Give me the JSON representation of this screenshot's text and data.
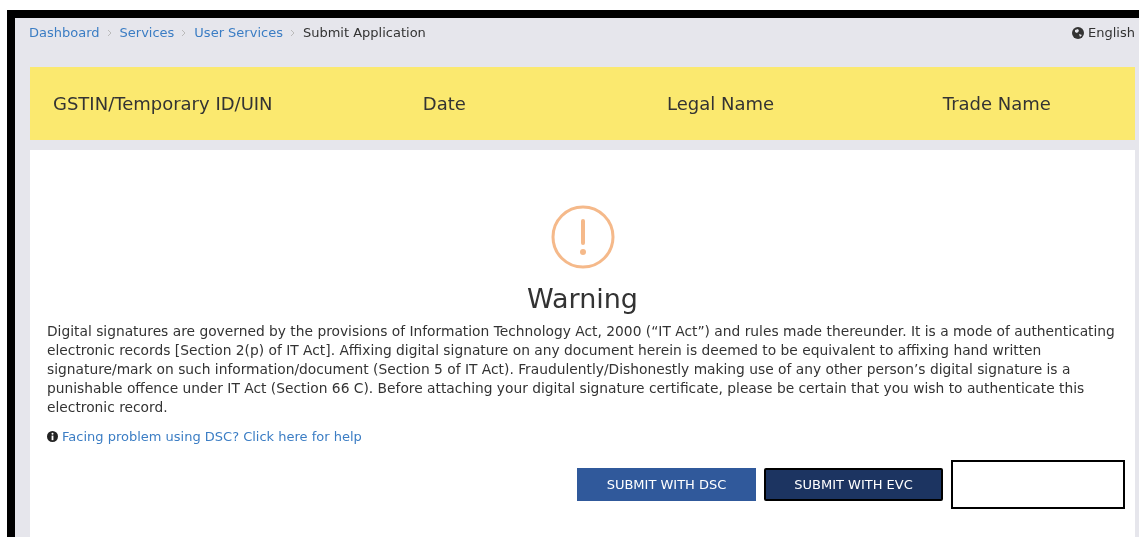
{
  "breadcrumb": [
    {
      "label": "Dashboard",
      "link": true
    },
    {
      "label": "Services",
      "link": true
    },
    {
      "label": "User Services",
      "link": true
    },
    {
      "label": "Submit Application",
      "link": false
    }
  ],
  "language": "English",
  "header_columns": [
    "GSTIN/Temporary ID/UIN",
    "Date",
    "Legal Name",
    "Trade Name"
  ],
  "warning": {
    "title": "Warning",
    "message": "Digital signatures are governed by the provisions of Information Technology Act, 2000 (“IT Act”) and rules made thereunder. It is a mode of authenticating electronic records [Section 2(p) of IT Act]. Affixing digital signature on any document herein is deemed to be equivalent to affixing hand written signature/mark on such information/document (Section 5 of IT Act). Fraudulently/Dishonestly making use of any other person’s digital signature is a punishable offence under IT Act (Section 66 C). Before attaching your digital signature certificate, please be certain that you wish to authenticate this electronic record.",
    "help_link": "Facing problem using DSC? Click here for help"
  },
  "buttons": [
    {
      "label": "SUBMIT WITH DSC",
      "selected": false
    },
    {
      "label": "SUBMIT WITH EVC",
      "selected": true
    }
  ]
}
